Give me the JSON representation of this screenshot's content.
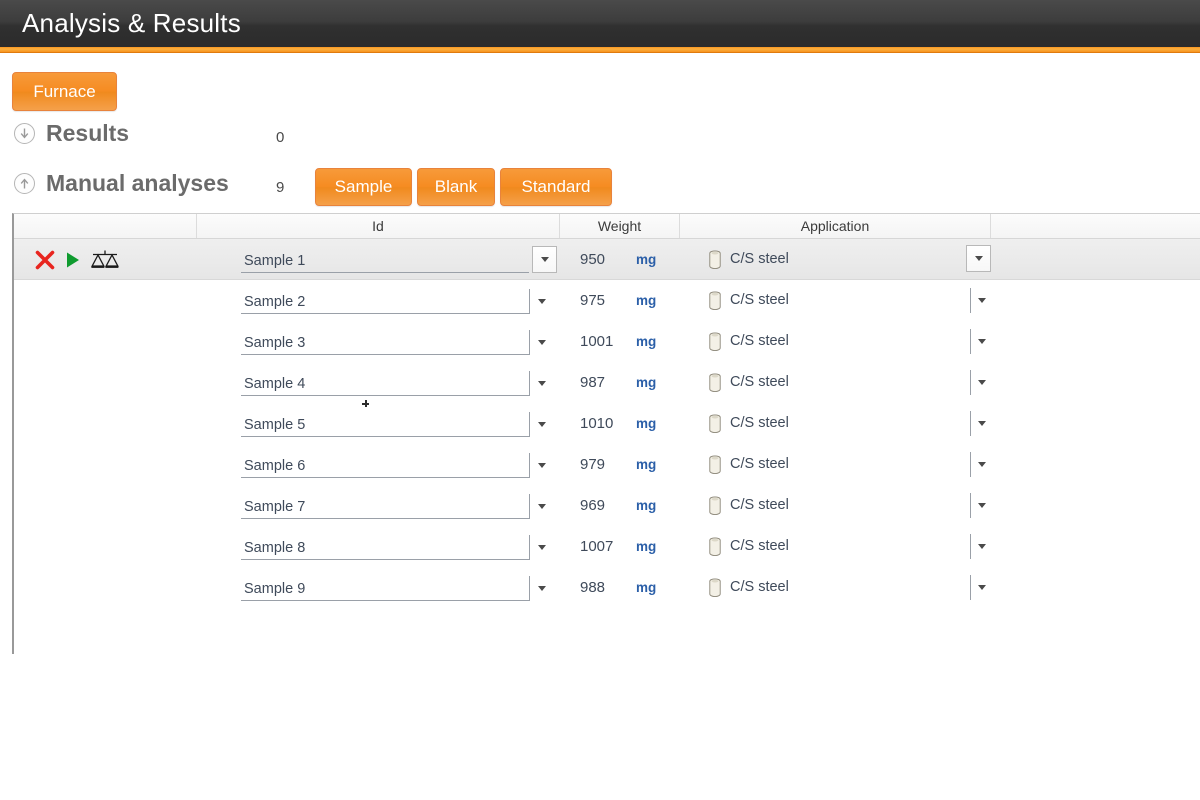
{
  "window": {
    "title": "Analysis & Results",
    "accent_color": "#f7941e",
    "titlebar_color": "#333333"
  },
  "toolbar": {
    "furnace_label": "Furnace"
  },
  "sections": {
    "results": {
      "label": "Results",
      "count": "0",
      "toggle_icon": "circle-arrow-down-icon",
      "expanded": false
    },
    "manual": {
      "label": "Manual analyses",
      "count": "9",
      "toggle_icon": "circle-arrow-up-icon",
      "expanded": true,
      "actions": [
        {
          "label": "Sample"
        },
        {
          "label": "Blank"
        },
        {
          "label": "Standard"
        }
      ]
    }
  },
  "table": {
    "columns": [
      {
        "key": "actions",
        "label": ""
      },
      {
        "key": "id",
        "label": "Id"
      },
      {
        "key": "weight",
        "label": "Weight"
      },
      {
        "key": "application",
        "label": "Application"
      },
      {
        "key": "spare",
        "label": ""
      }
    ],
    "row_icons": {
      "delete": "red-x-icon",
      "run": "green-play-icon",
      "balance": "balance-scale-icon"
    },
    "unit": "mg",
    "rows": [
      {
        "id": "Sample 1",
        "weight": "950",
        "unit": "mg",
        "application": "C/S steel",
        "selected": true
      },
      {
        "id": "Sample 2",
        "weight": "975",
        "unit": "mg",
        "application": "C/S steel",
        "selected": false
      },
      {
        "id": "Sample 3",
        "weight": "1001",
        "unit": "mg",
        "application": "C/S steel",
        "selected": false
      },
      {
        "id": "Sample 4",
        "weight": "987",
        "unit": "mg",
        "application": "C/S steel",
        "selected": false
      },
      {
        "id": "Sample 5",
        "weight": "1010",
        "unit": "mg",
        "application": "C/S steel",
        "selected": false
      },
      {
        "id": "Sample 6",
        "weight": "979",
        "unit": "mg",
        "application": "C/S steel",
        "selected": false
      },
      {
        "id": "Sample 7",
        "weight": "969",
        "unit": "mg",
        "application": "C/S steel",
        "selected": false
      },
      {
        "id": "Sample 8",
        "weight": "1007",
        "unit": "mg",
        "application": "C/S steel",
        "selected": false
      },
      {
        "id": "Sample 9",
        "weight": "988",
        "unit": "mg",
        "application": "C/S steel",
        "selected": false
      }
    ]
  }
}
